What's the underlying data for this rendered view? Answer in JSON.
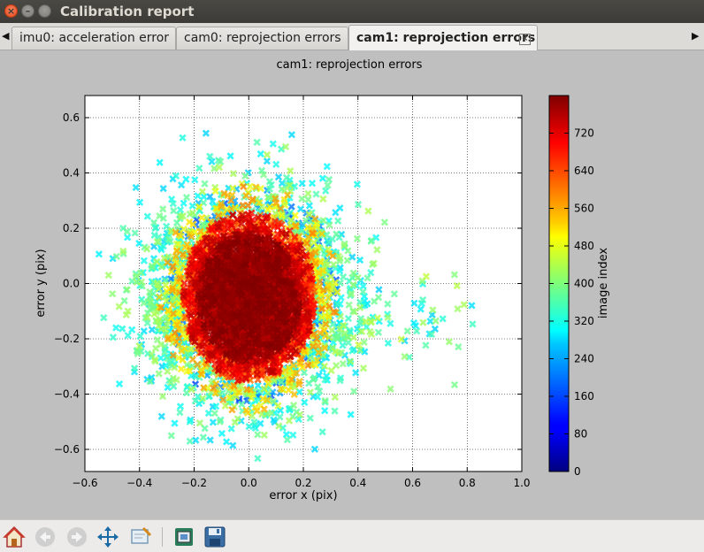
{
  "window": {
    "title": "Calibration report"
  },
  "tabs": [
    {
      "label": "imu0: acceleration error"
    },
    {
      "label": "cam0: reprojection errors"
    },
    {
      "label": "cam1: reprojection errors"
    }
  ],
  "chart_data": {
    "type": "scatter",
    "title": "cam1: reprojection errors",
    "xlabel": "error x (pix)",
    "ylabel": "error y (pix)",
    "xlim": [
      -0.6,
      1.0
    ],
    "ylim": [
      -0.68,
      0.68
    ],
    "xticks": [
      "−0.6",
      "−0.4",
      "−0.2",
      "0.0",
      "0.2",
      "0.4",
      "0.6",
      "0.8",
      "1.0"
    ],
    "yticks": [
      "0.6",
      "0.4",
      "0.2",
      "0.0",
      "−0.2",
      "−0.4",
      "−0.6"
    ],
    "grid": true,
    "marker": "x",
    "colormap": "jet",
    "colorbar": {
      "label": "image index",
      "range": [
        0,
        800
      ],
      "ticks": [
        "0",
        "80",
        "160",
        "240",
        "320",
        "400",
        "480",
        "560",
        "640",
        "720"
      ]
    },
    "point_cloud": {
      "center": [
        0.0,
        -0.05
      ],
      "spread_x": 0.16,
      "spread_y": 0.17,
      "dense_core_radius_x": 0.22,
      "dense_core_radius_y": 0.28,
      "outlier_extent_x": [
        -0.45,
        0.82
      ]
    }
  },
  "toolbar": {
    "buttons": [
      "home-icon",
      "back-arrow-icon",
      "forward-arrow-icon",
      "pan-icon",
      "zoom-icon",
      "subplot-config-icon",
      "save-icon"
    ]
  }
}
